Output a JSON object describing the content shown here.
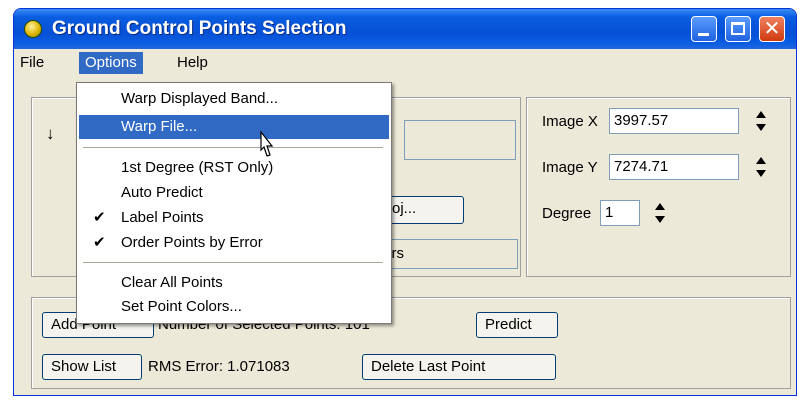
{
  "window": {
    "title": "Ground Control Points Selection"
  },
  "menubar": {
    "file": "File",
    "options": "Options",
    "help": "Help"
  },
  "options_menu": {
    "warp_displayed_band": "Warp Displayed Band...",
    "warp_file": "Warp File...",
    "first_degree": "1st Degree (RST Only)",
    "auto_predict": "Auto Predict",
    "label_points": "Label Points",
    "order_points": "Order Points by Error",
    "clear_all_points": "Clear All Points",
    "set_point_colors": "Set Point Colors...",
    "check_glyph": "✔"
  },
  "left_panel": {
    "arrow_glyph": "↓",
    "proj_button": "Proj...",
    "partial_button": "ters"
  },
  "right_panel": {
    "image_x_label": "Image X",
    "image_x_value": "3997.57",
    "image_y_label": "Image Y",
    "image_y_value": "7274.71",
    "degree_label": "Degree",
    "degree_value": "1"
  },
  "bottom_panel": {
    "add_point_partial": "Add Point",
    "selected_points_partial": "Number of Selected Points: 101",
    "predict_button": "Predict",
    "show_list_button": "Show List",
    "rms_error": "RMS Error: 1.071083",
    "delete_last_point_button": "Delete Last Point"
  }
}
